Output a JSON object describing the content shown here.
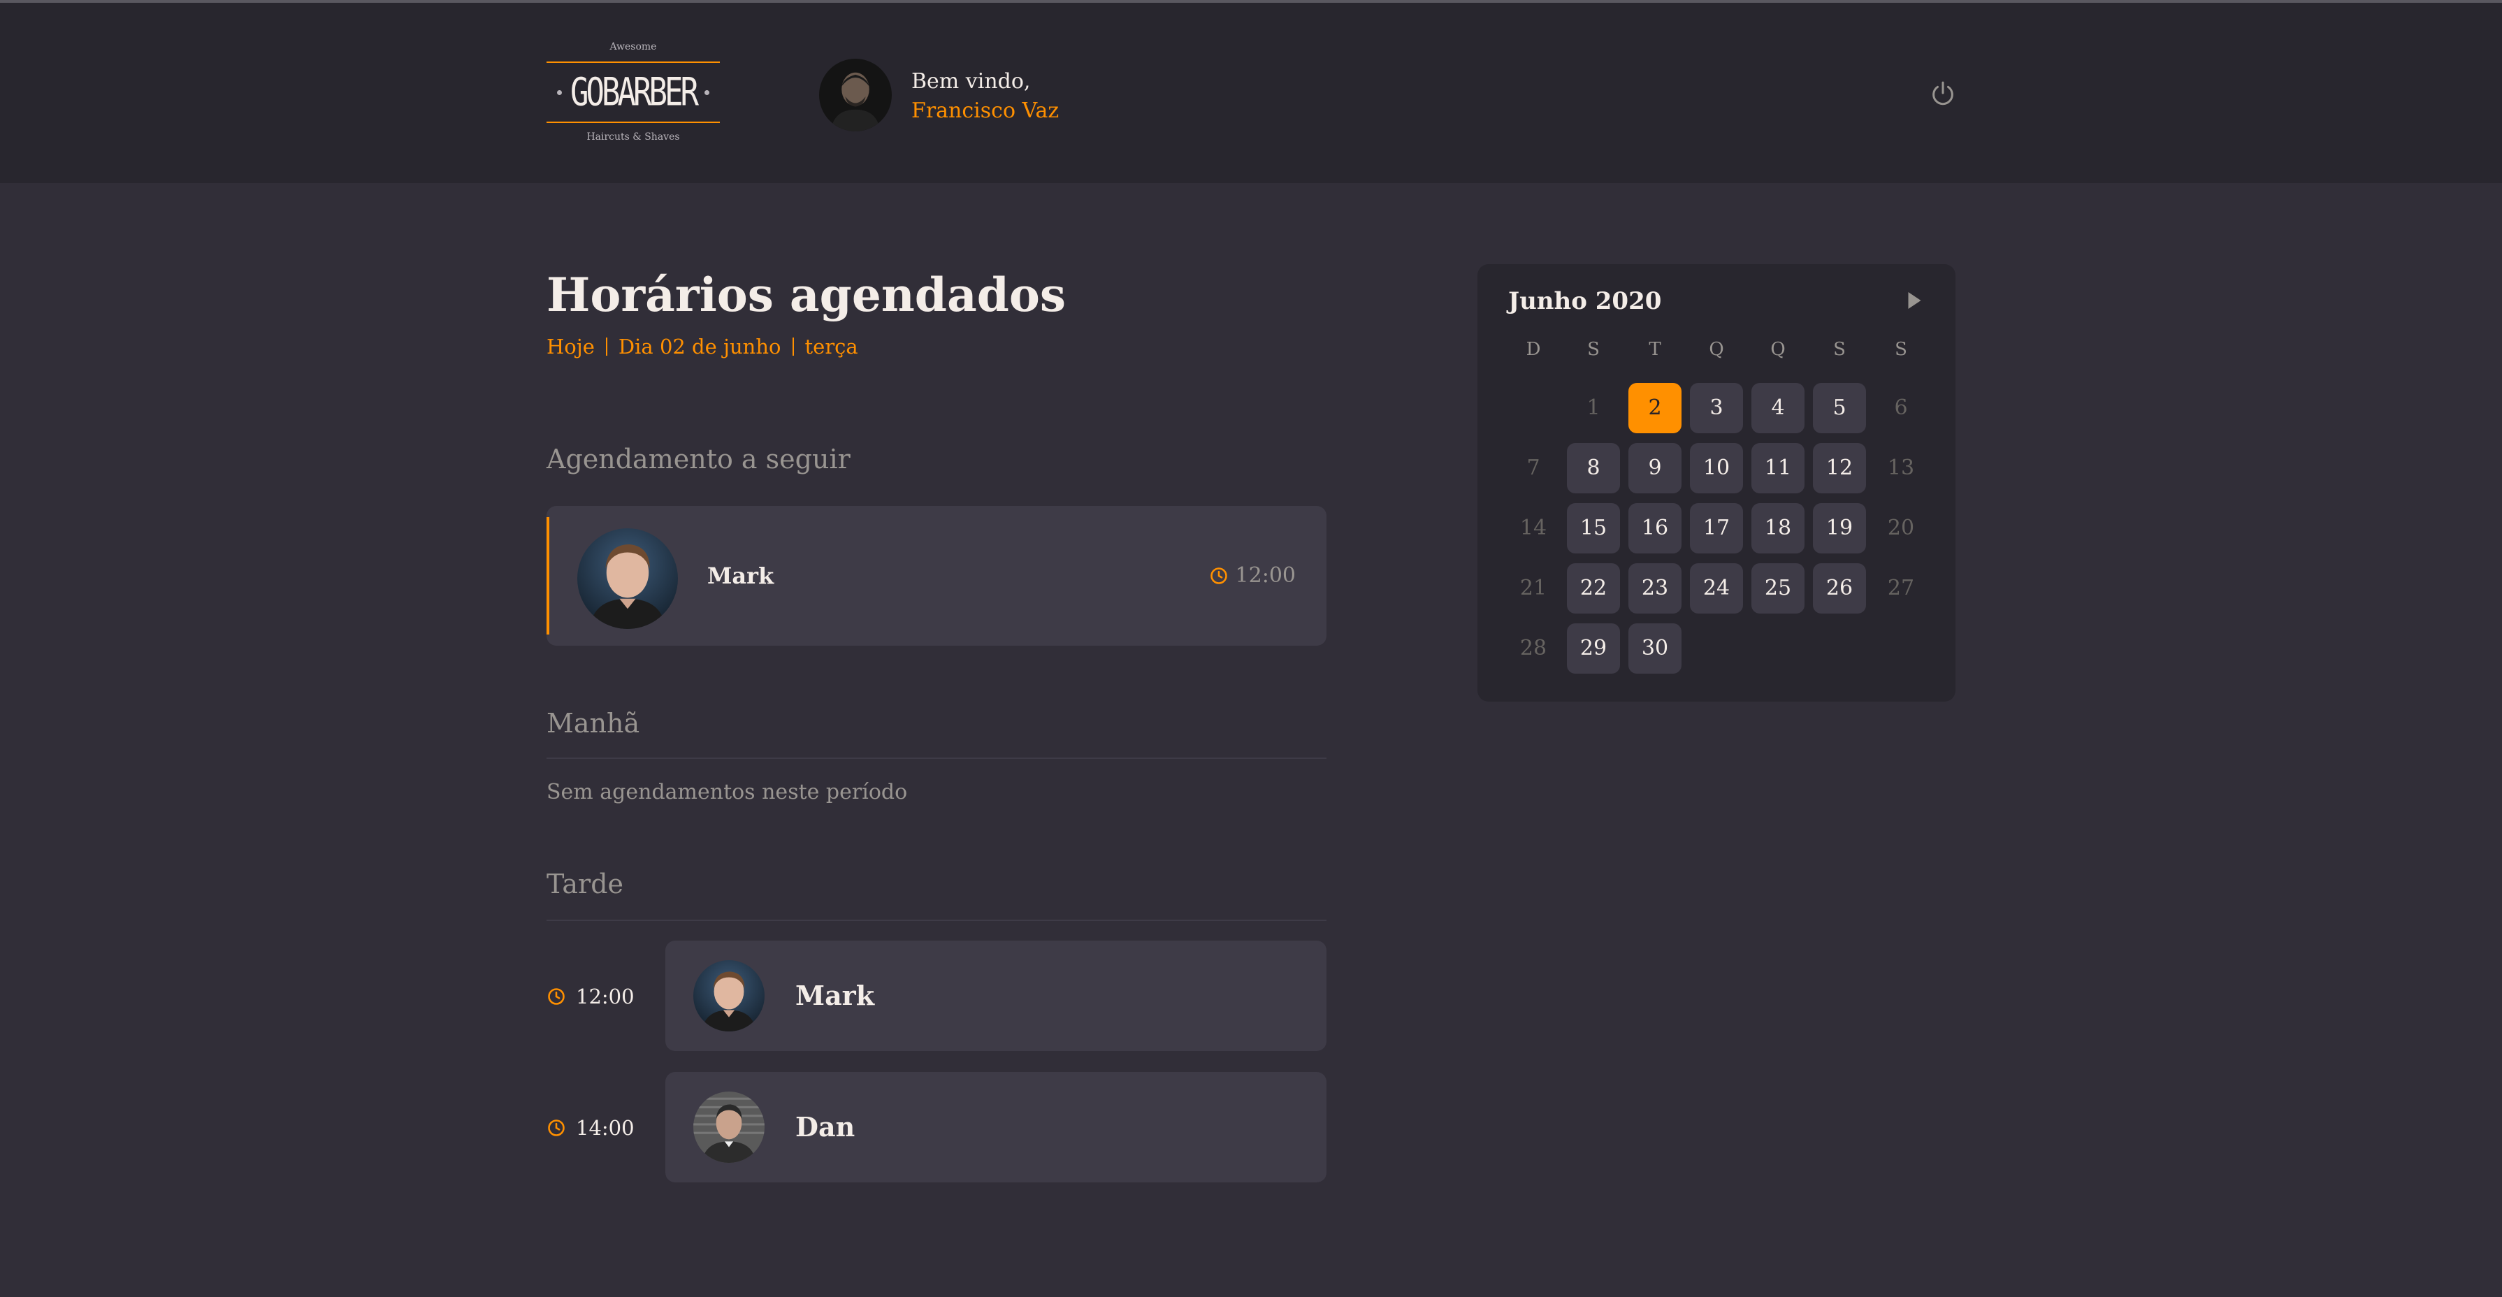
{
  "header": {
    "logo": {
      "top": "Awesome",
      "main": "GOBARBER",
      "bottom": "Haircuts & Shaves"
    },
    "welcome_label": "Bem vindo,",
    "user_name": "Francisco Vaz",
    "power_icon": "power-icon"
  },
  "main": {
    "title": "Horários agendados",
    "date": {
      "today": "Hoje",
      "day": "Dia 02 de junho",
      "weekday": "terça"
    },
    "next": {
      "heading": "Agendamento a seguir",
      "name": "Mark",
      "time": "12:00"
    },
    "morning": {
      "heading": "Manhã",
      "empty": "Sem agendamentos neste período"
    },
    "afternoon": {
      "heading": "Tarde",
      "appointments": [
        {
          "time": "12:00",
          "name": "Mark"
        },
        {
          "time": "14:00",
          "name": "Dan"
        }
      ]
    }
  },
  "calendar": {
    "month": "Junho 2020",
    "weekdays": [
      "D",
      "S",
      "T",
      "Q",
      "Q",
      "S",
      "S"
    ],
    "weeks": [
      [
        null,
        "1",
        "2",
        "3",
        "4",
        "5",
        "6"
      ],
      [
        "7",
        "8",
        "9",
        "10",
        "11",
        "12",
        "13"
      ],
      [
        "14",
        "15",
        "16",
        "17",
        "18",
        "19",
        "20"
      ],
      [
        "21",
        "22",
        "23",
        "24",
        "25",
        "26",
        "27"
      ],
      [
        "28",
        "29",
        "30",
        null,
        null,
        null,
        null
      ]
    ],
    "selected": "2",
    "disabled_past": [
      "1"
    ]
  },
  "colors": {
    "accent": "#ff9000",
    "background": "#312e38",
    "header": "#28262e",
    "card": "#3e3b47"
  }
}
